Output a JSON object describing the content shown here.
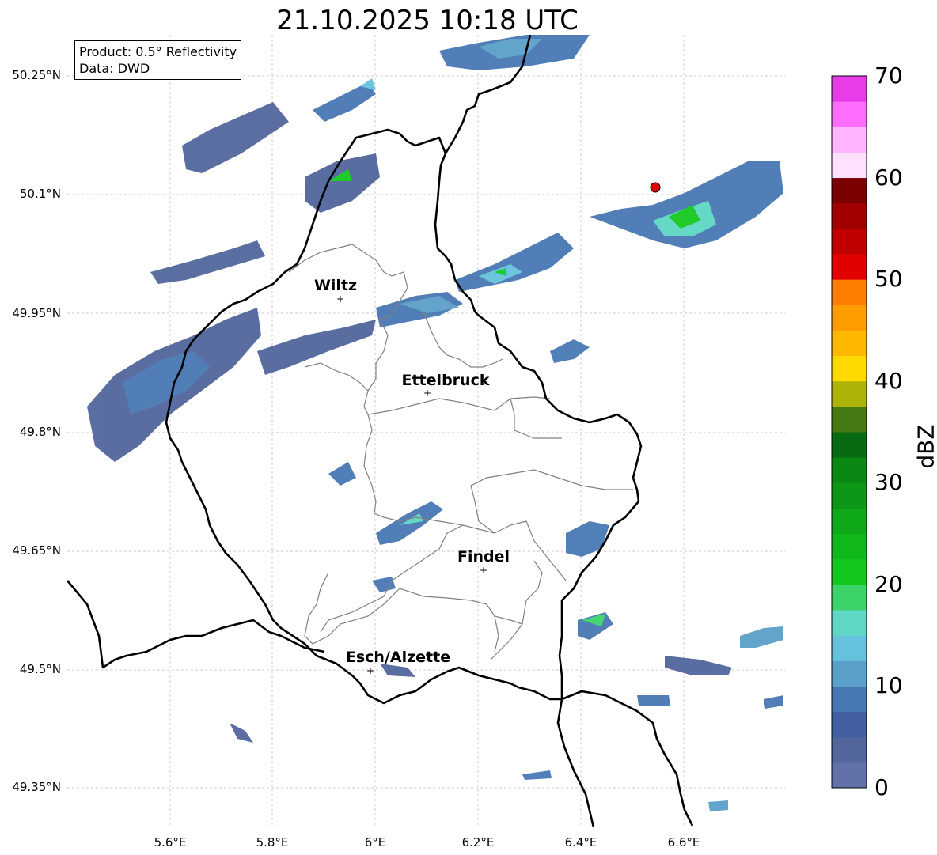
{
  "title": "21.10.2025 10:18 UTC",
  "info": {
    "product": "Product: 0.5° Reflectivity",
    "data_source": "Data: DWD"
  },
  "axes": {
    "lon_ticks": [
      "5.6°E",
      "5.8°E",
      "6°E",
      "6.2°E",
      "6.4°E",
      "6.6°E"
    ],
    "lat_ticks": [
      "50.25°N",
      "50.1°N",
      "49.95°N",
      "49.8°N",
      "49.65°N",
      "49.5°N",
      "49.35°N"
    ]
  },
  "cities": [
    {
      "name": "Wiltz",
      "lon": 5.93,
      "lat": 49.97
    },
    {
      "name": "Ettelbruck",
      "lon": 6.1,
      "lat": 49.85
    },
    {
      "name": "Findel",
      "lon": 6.21,
      "lat": 49.63
    },
    {
      "name": "Esch/Alzette",
      "lon": 5.99,
      "lat": 49.5
    }
  ],
  "radar_marker": {
    "lon": 6.55,
    "lat": 50.11,
    "color": "#e00000"
  },
  "colorbar": {
    "unit": "dBZ",
    "min": 0,
    "max": 70,
    "tick_labels": [
      "0",
      "10",
      "20",
      "30",
      "40",
      "50",
      "60",
      "70"
    ],
    "colors": [
      "#6272a8",
      "#52669c",
      "#4460a2",
      "#4878b4",
      "#5aa0c8",
      "#66c2dc",
      "#5ed8c4",
      "#3cd46a",
      "#14c81e",
      "#10b81c",
      "#0ea818",
      "#0c9816",
      "#0a8814",
      "#086a12",
      "#467814",
      "#acb408",
      "#ffd800",
      "#ffb800",
      "#ff9c00",
      "#ff7e00",
      "#e00000",
      "#c00000",
      "#a00000",
      "#7a0000",
      "#ffe0ff",
      "#ffb4ff",
      "#ff6cff",
      "#e83ce8"
    ]
  },
  "colors": {
    "border_country": "#000000",
    "border_canton": "#808080",
    "grid": "#bbbbbb"
  }
}
